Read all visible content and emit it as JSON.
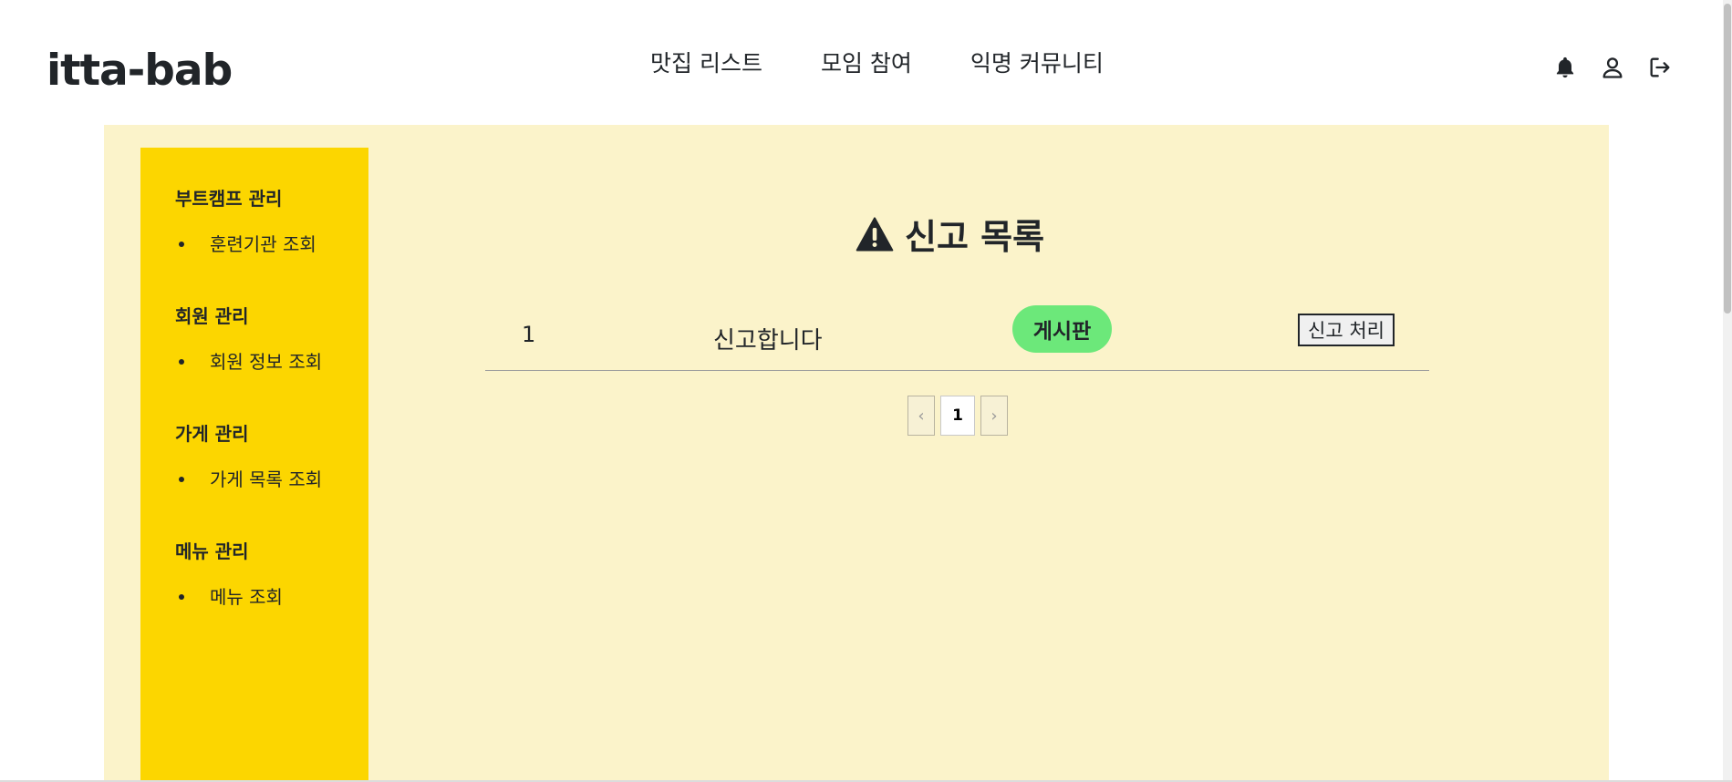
{
  "header": {
    "logo": "itta-bab",
    "nav": [
      "맛집 리스트",
      "모임 참여",
      "익명 커뮤니티"
    ],
    "icons": [
      "bell-icon",
      "user-icon",
      "logout-icon"
    ]
  },
  "sidebar": {
    "groups": [
      {
        "title": "부트캠프 관리",
        "items": [
          "훈련기관 조회"
        ]
      },
      {
        "title": "회원 관리",
        "items": [
          "회원 정보 조회"
        ]
      },
      {
        "title": "가게 관리",
        "items": [
          "가게 목록 조회"
        ]
      },
      {
        "title": "메뉴 관리",
        "items": [
          "메뉴 조회"
        ]
      }
    ]
  },
  "main": {
    "title": "신고 목록",
    "title_icon": "warning-icon",
    "reports": [
      {
        "number": "1",
        "title": "신고합니다",
        "category": "게시판",
        "action": "신고 처리"
      }
    ],
    "pagination": {
      "prev": "‹",
      "current": "1",
      "next": "›"
    }
  },
  "colors": {
    "sidebar_bg": "#fcd600",
    "content_bg": "#fbf3ca",
    "badge_bg": "#6ce87a"
  }
}
